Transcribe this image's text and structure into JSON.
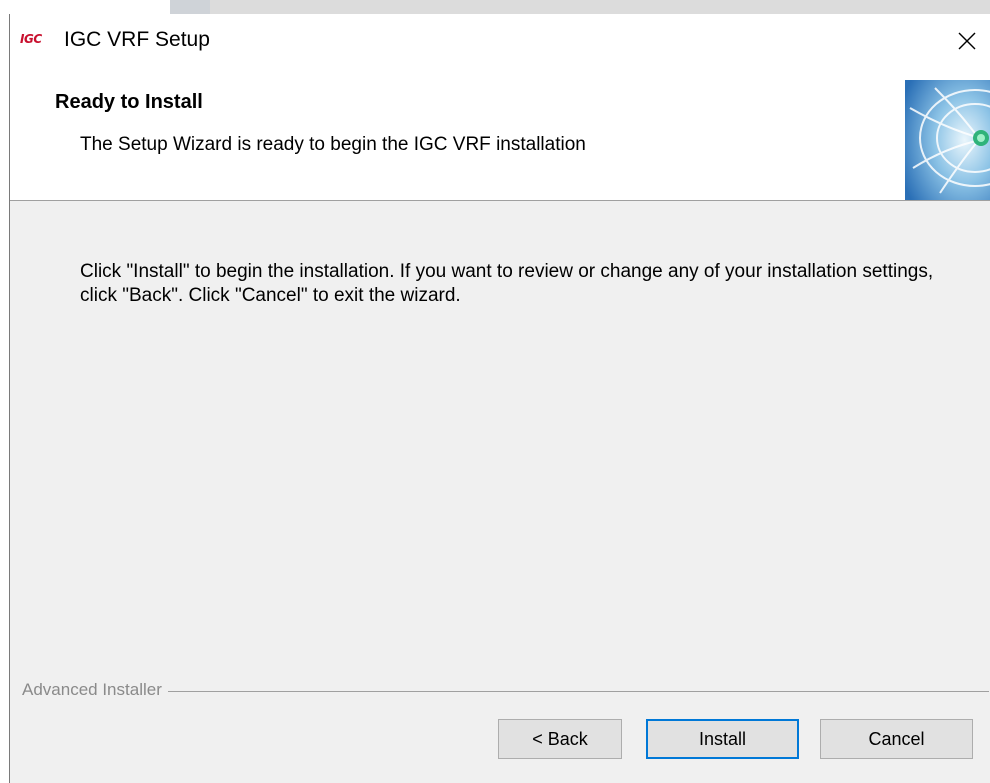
{
  "window": {
    "logo_text": "IGC",
    "title": "IGC VRF Setup"
  },
  "header": {
    "title": "Ready to Install",
    "description": "The Setup Wizard is ready to begin the IGC VRF installation"
  },
  "body": {
    "instructions": "Click \"Install\" to begin the installation.  If you want to review or change any of your installation settings, click \"Back\".  Click \"Cancel\" to exit the wizard."
  },
  "footer": {
    "brand_label": "Advanced Installer"
  },
  "buttons": {
    "back": "< Back",
    "install": "Install",
    "cancel": "Cancel"
  },
  "colors": {
    "logo": "#c8102e",
    "default_button_border": "#0078d7",
    "dialog_bg": "#f0f0f0"
  },
  "icons": {
    "close": "close-icon",
    "banner": "wizard-banner-graphic"
  }
}
